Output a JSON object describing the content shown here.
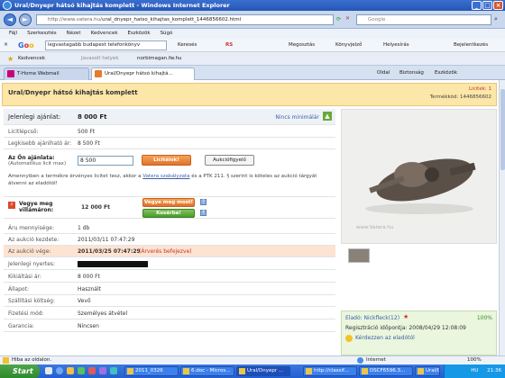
{
  "window": {
    "title": "Ural/Dnyepr hátsó kihajtás komplett - Windows Internet Explorer"
  },
  "address": {
    "url_prefix": "http://www.vatera.hu/",
    "url_rest": "ural_dnyepr_hatso_kihajtas_komplett_1446856602.html",
    "search_placeholder": "Google"
  },
  "menu": [
    "Fájl",
    "Szerkesztés",
    "Nézet",
    "Kedvencek",
    "Eszközök",
    "Súgó"
  ],
  "gtoolbar": {
    "query": "legvastagabb budapest telefonkönyv",
    "items": [
      "Keresés",
      "RS",
      "Megosztás",
      "Könyvjelző",
      "Helyesírás",
      "Bejelentkezés"
    ]
  },
  "favbar": {
    "favorites": "Kedvencek",
    "suggested": "Javasolt helyek",
    "link": "norbimagan.fw.hu"
  },
  "tabs": {
    "t1": "T-Home Webmail",
    "t2": "Ural/Dnyepr hátsó kihajtá...",
    "cmds": [
      "Oldal",
      "Biztonság",
      "Eszközök"
    ]
  },
  "header": {
    "title": "Ural/Dnyepr hátsó kihajtás komplett",
    "count": "Licitek: 1",
    "termek": "Termékkód: 1446856602"
  },
  "bid": {
    "cur_label": "Jelenlegi ajánlat:",
    "cur_value": "8 000 Ft",
    "min_note": "Nincs minimálár",
    "step_label": "Licitlépcső:",
    "step_value": "500 Ft",
    "lowest_label": "Legkisebb ajánlható ár:",
    "lowest_value": "8 500 Ft",
    "your_label": "Az Ön ajánlata:",
    "your_sub": "(Automatikus licit max)",
    "your_value": "8 500",
    "bid_btn": "Licitálok!",
    "watch_btn": "Aukciófigyelő",
    "terms_a": "Amennyiben a termékre érvényes licitet tesz, akkor a ",
    "terms_link": "Vatera szabályzata",
    "terms_b": " és a PTK 211. § szerint is köteles az aukció tárgyát átvenni az eladótól!",
    "buy_label": "Vegye meg villámáron:",
    "buy_value": "12 000 Ft",
    "buy_btn": "Vegye meg most!",
    "cart_btn": "Kosárba!"
  },
  "details": [
    {
      "label": "Áru mennyisége:",
      "value": "1 db"
    },
    {
      "label": "Az aukció kezdete:",
      "value": "2011/03/11 07:47:29"
    },
    {
      "label": "Az aukció vége:",
      "value": "2011/03/25 07:47:29",
      "extra": "(Árverés befejezve)"
    },
    {
      "label": "Jelenlegi nyertes:",
      "value": ""
    },
    {
      "label": "Kikiáltási ár:",
      "value": "8 000 Ft"
    },
    {
      "label": "Állapot:",
      "value": "Használt"
    },
    {
      "label": "Szállítási költség:",
      "value": "Vevő"
    },
    {
      "label": "Fizetési mód:",
      "value": "Személyes átvétel"
    },
    {
      "label": "Garancia:",
      "value": "Nincsen"
    }
  ],
  "photo": {
    "watermark": "www.Vatera.hu"
  },
  "seller": {
    "name": "Eladó: Nickfleck(12)",
    "pct": "100%",
    "reg": "Regisztráció időpontja: 2008/04/29 12:08:09",
    "ask": "Kérdezzen az eladótól"
  },
  "status": {
    "left": "Hiba az oldalon.",
    "zone": "Internet",
    "zoom": "100%"
  },
  "taskbar": {
    "start": "Start",
    "tasks": [
      "2011_0326",
      "6.doc - Micros...",
      "Ural/Dnyepr ...",
      "http://classif...",
      "DSCF6596.3...",
      "Ural/Dnyepr ..."
    ],
    "clock": "21:36",
    "lang": "HU"
  }
}
